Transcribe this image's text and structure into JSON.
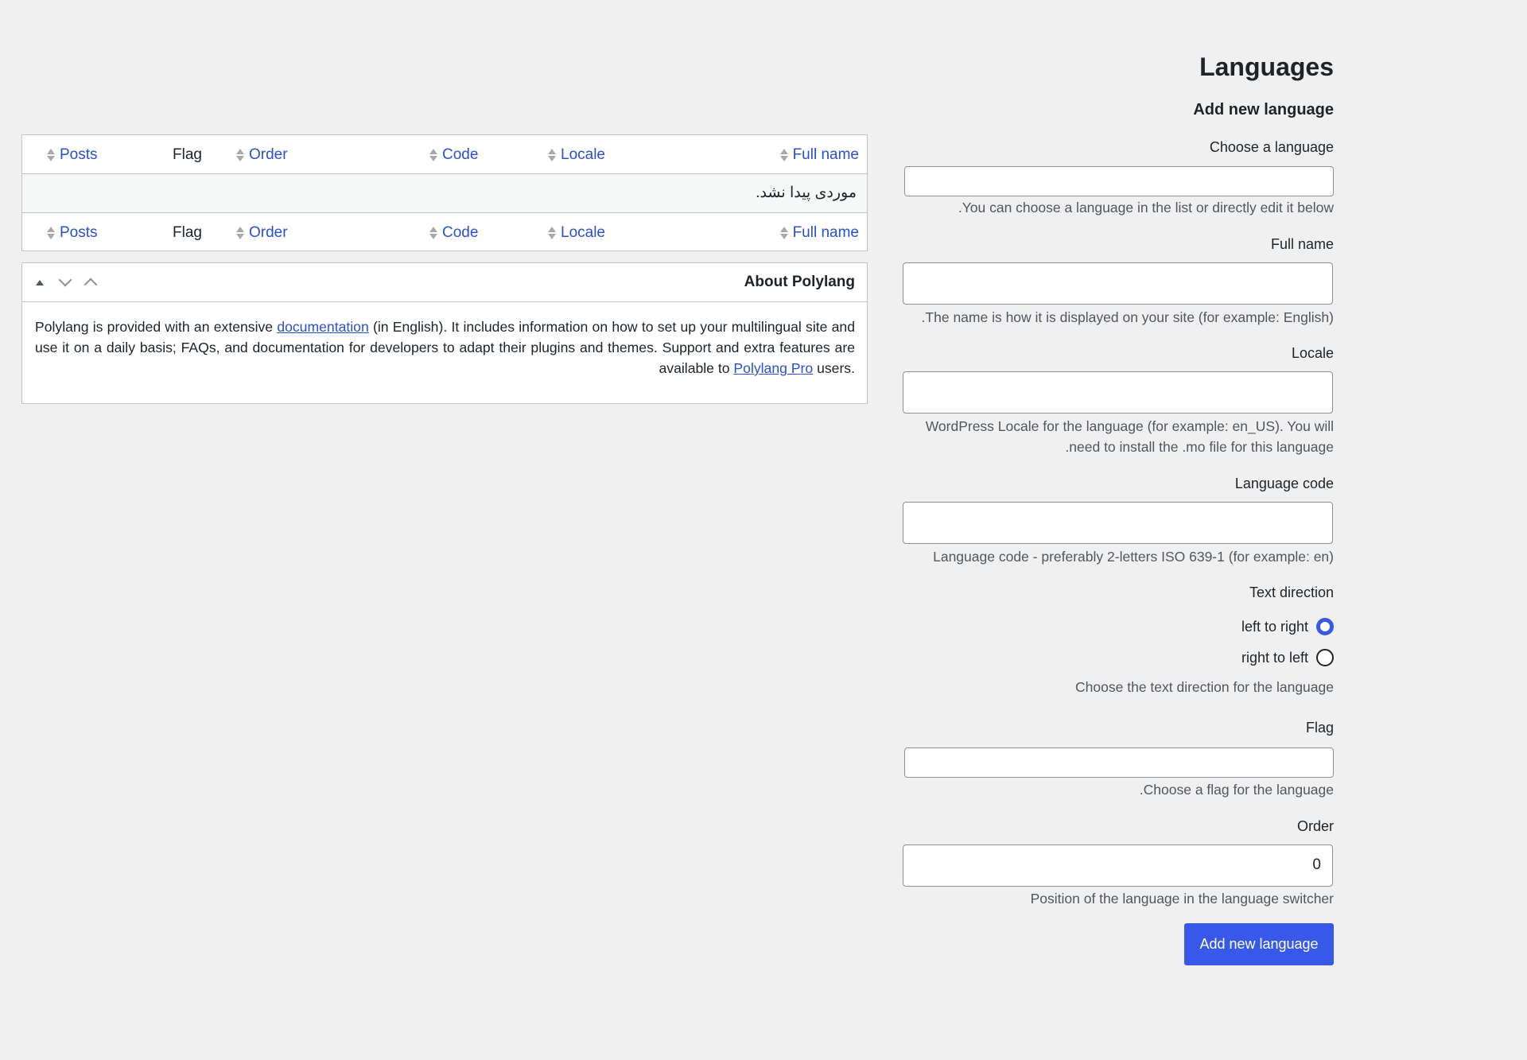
{
  "page": {
    "title": "Languages",
    "form_title": "Add new language"
  },
  "form": {
    "choose_language": {
      "label": "Choose a language",
      "value": "",
      "description": "You can choose a language in the list or directly edit it below."
    },
    "full_name": {
      "label": "Full name",
      "value": "",
      "description": "The name is how it is displayed on your site (for example: English)."
    },
    "locale": {
      "label": "Locale",
      "value": "",
      "description": "WordPress Locale for the language (for example: en_US). You will need to install the .mo file for this language."
    },
    "language_code": {
      "label": "Language code",
      "value": "",
      "description": "Language code - preferably 2-letters ISO 639-1 (for example: en)"
    },
    "text_direction": {
      "label": "Text direction",
      "options": [
        {
          "label": "left to right",
          "checked": true
        },
        {
          "label": "right to left",
          "checked": false
        }
      ],
      "description": "Choose the text direction for the language"
    },
    "flag": {
      "label": "Flag",
      "value": "",
      "description": "Choose a flag for the language."
    },
    "order": {
      "label": "Order",
      "value": "0",
      "description": "Position of the language in the language switcher"
    },
    "submit_label": "Add new language"
  },
  "table": {
    "columns": {
      "full_name": "Full name",
      "locale": "Locale",
      "code": "Code",
      "order": "Order",
      "flag": "Flag",
      "posts": "Posts"
    },
    "empty_message": "موردی پیدا نشد."
  },
  "about_box": {
    "title": "About Polylang",
    "text_before": "Polylang is provided with an extensive ",
    "doc_link": "documentation",
    "text_middle": " (in English). It includes information on how to set up your multilingual site and use it on a daily basis; FAQs, and documentation for developers to adapt their plugins and themes. Support and extra features are available to ",
    "pro_link": "Polylang Pro",
    "text_after": " users."
  },
  "colors": {
    "primary": "#3858e9",
    "link": "#2a4fd1",
    "background": "#f0f0f1"
  }
}
